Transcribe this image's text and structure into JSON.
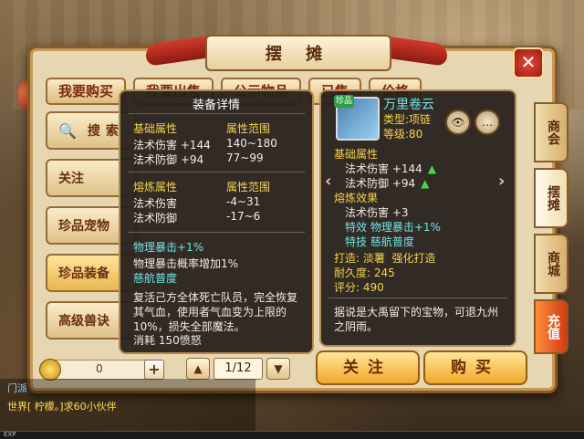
{
  "window": {
    "title": "摆 摊",
    "close": "✕"
  },
  "top_tabs": [
    "我要购买",
    "我要出售",
    "公示物品",
    "已售",
    "价格"
  ],
  "left_menu": {
    "search": "搜索",
    "items": [
      "关注",
      "珍品宠物",
      "珍品装备",
      "高级兽诀"
    ]
  },
  "side_tabs": [
    "商会",
    "摆摊",
    "商城",
    "充值"
  ],
  "equip_detail": {
    "title": "装备详情",
    "base_header": "基础属性",
    "range_header": "属性范围",
    "base_rows": [
      {
        "name": "法术伤害 +144",
        "range": "140~180"
      },
      {
        "name": "法术防御 +94",
        "range": "77~99"
      }
    ],
    "refine_header": "熔炼属性",
    "refine_range_header": "属性范围",
    "refine_rows": [
      {
        "name": "法术伤害",
        "range": "-4~31"
      },
      {
        "name": "法术防御",
        "range": "-17~6"
      }
    ],
    "effect1": "物理暴击+1%",
    "effect1_desc": "物理暴击概率增加1%",
    "skill_name": "慈航普度",
    "skill_desc": "复活己方全体死亡队员，完全恢复其气血，使用者气血变为上限的10%，损失全部魔法。",
    "skill_cost": "消耗 150愤怒"
  },
  "item_card": {
    "badge": "珍品",
    "name": "万里卷云",
    "type": "类型:项链",
    "level": "等级:80",
    "base_header": "基础属性",
    "base_rows": [
      "法术伤害 +144",
      "法术防御 +94"
    ],
    "refine_header": "熔炼效果",
    "refine_row": "法术伤害 +3",
    "special_effect": "特效 物理暴击+1%",
    "special_skill": "特技 慈航普度",
    "forge": "打造: 淡薯",
    "forge_strong": "强化打造",
    "durability": "耐久度: 245",
    "score": "评分: 490",
    "description": "据说是大禹留下的宝物，可退九州之阴雨。"
  },
  "bottom": {
    "money": "0",
    "plus": "+",
    "page": "1/12",
    "follow_button": "关注",
    "buy_button": "购买"
  },
  "chat": {
    "line1": "门派",
    "line2": "世界[ 柠檬。]求60小伙伴",
    "exp": "EXP"
  },
  "colors": {
    "accent_yellow": "#f6d34a",
    "accent_cyan": "#6ee4e8",
    "frame": "#e7d6b2"
  }
}
